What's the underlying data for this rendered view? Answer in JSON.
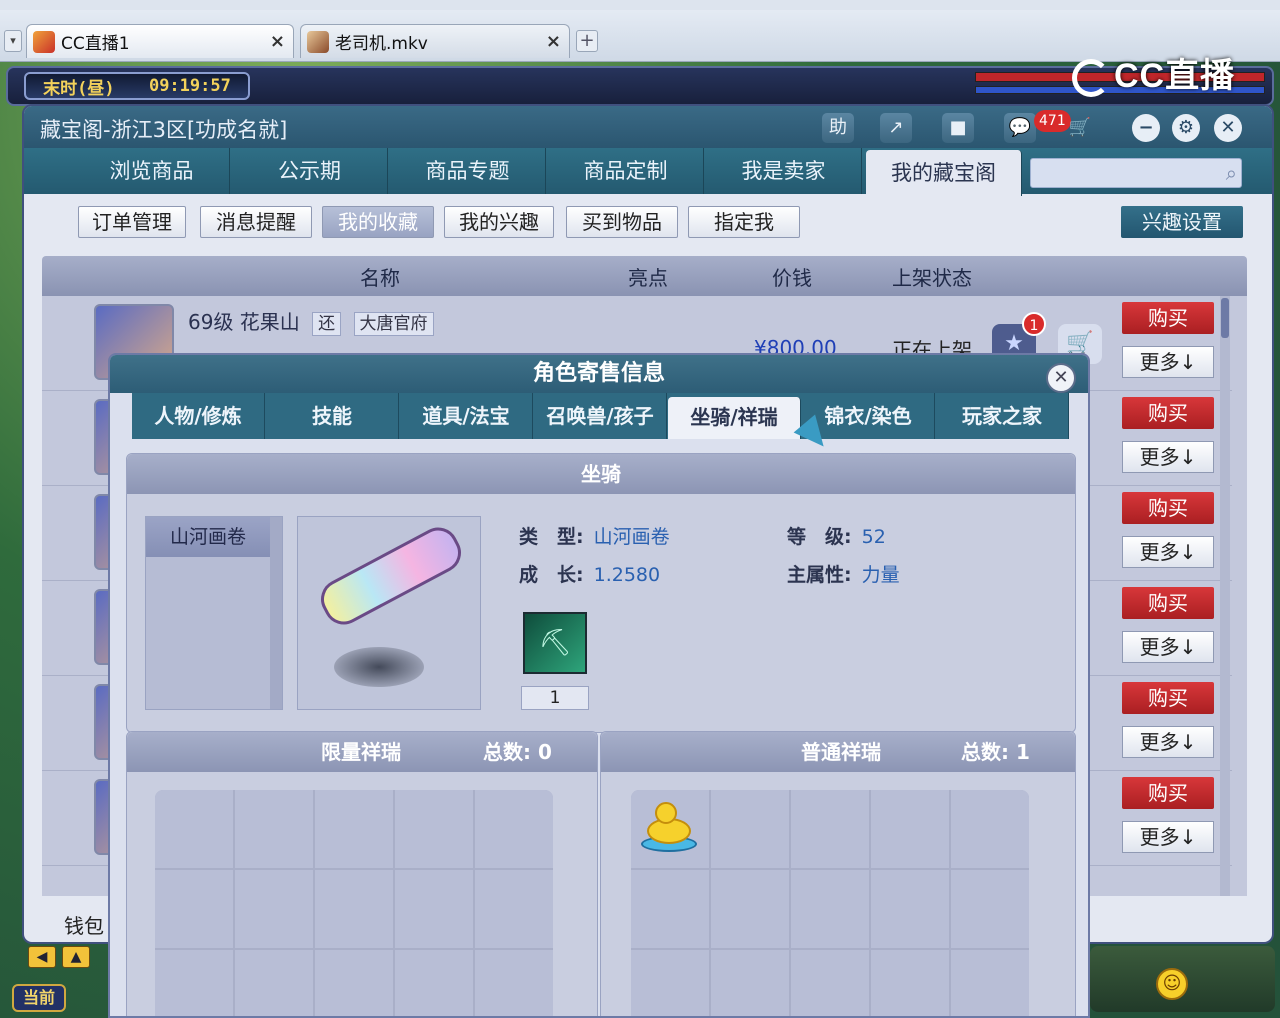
{
  "browser": {
    "tabs": [
      {
        "label": "CC直播1",
        "close": "×"
      },
      {
        "label": "老司机.mkv",
        "close": "×"
      }
    ],
    "new_tab": "+",
    "menu": "▾"
  },
  "watermark": "CC直播",
  "hud": {
    "time_period": "末时(昼)",
    "clock": "09:19:57",
    "current": "当前"
  },
  "window": {
    "title": "藏宝阁-浙江3区[功成名就]",
    "help_label": "助",
    "share_icon": "↗",
    "stop_icon": "■",
    "chat_count": "471",
    "minimize": "−",
    "settings": "⚙",
    "close": "✕",
    "nav": [
      "浏览商品",
      "公示期",
      "商品专题",
      "商品定制",
      "我是卖家",
      "我的藏宝阁"
    ],
    "nav_active": 5,
    "search_placeholder": "",
    "subnav": [
      "订单管理",
      "消息提醒",
      "我的收藏",
      "我的兴趣",
      "买到物品",
      "指定我"
    ],
    "subnav_active": 2,
    "interest_settings": "兴趣设置",
    "columns": [
      "名称",
      "亮点",
      "价钱",
      "上架状态"
    ],
    "first_item": {
      "name": "69级 花果山",
      "tags": [
        "还",
        "大唐官府"
      ],
      "price": "¥800.00",
      "status": "正在上架",
      "fav_badge": "1"
    },
    "buy_label": "购买",
    "more_label": "更多↓",
    "wallet": "钱包"
  },
  "modal": {
    "title": "角色寄售信息",
    "close": "✕",
    "tabs": [
      "人物/修炼",
      "技能",
      "道具/法宝",
      "召唤兽/孩子",
      "坐骑/祥瑞",
      "锦衣/染色",
      "玩家之家"
    ],
    "tab_active": 4,
    "section_title": "坐骑",
    "mount_list": [
      "山河画卷"
    ],
    "mount": {
      "type_label": "类　型:",
      "type_value": "山河画卷",
      "level_label": "等　级:",
      "level_value": "52",
      "growth_label": "成　长:",
      "growth_value": "1.2580",
      "attr_label": "主属性:",
      "attr_value": "力量",
      "skill_count": "1"
    },
    "limited": {
      "title": "限量祥瑞",
      "count_label": "总数:",
      "count": "0"
    },
    "normal": {
      "title": "普通祥瑞",
      "count_label": "总数:",
      "count": "1"
    }
  },
  "colors": {
    "nav_bg": "#2f6f86",
    "buy_red": "#d8373a",
    "value_blue": "#2960b0"
  }
}
